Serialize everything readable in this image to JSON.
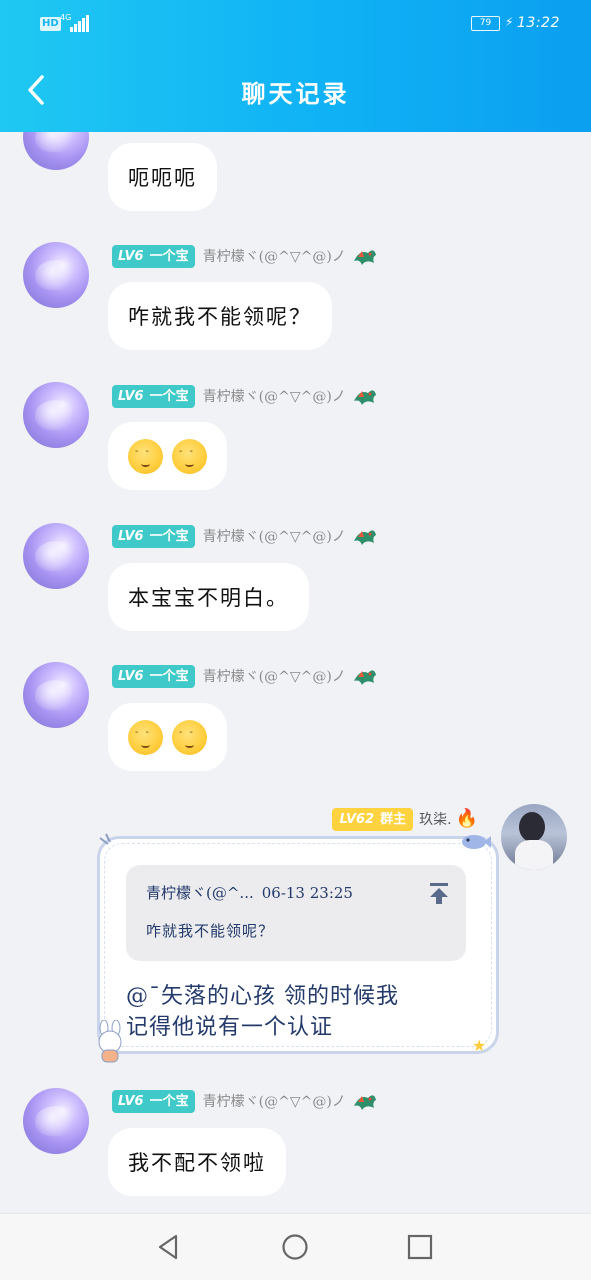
{
  "status_bar": {
    "hd": "HD",
    "network": "4G",
    "battery": "79",
    "time": "13:22"
  },
  "header": {
    "title": "聊天记录"
  },
  "messages": [
    {
      "text": "呃呃呃"
    },
    {
      "level": "LV6",
      "title": "一个宝",
      "name": "青柠檬ヾ(@^▽^@)ノ",
      "text": "咋就我不能领呢？"
    },
    {
      "level": "LV6",
      "title": "一个宝",
      "name": "青柠檬ヾ(@^▽^@)ノ",
      "emoji_count": 2
    },
    {
      "level": "LV6",
      "title": "一个宝",
      "name": "青柠檬ヾ(@^▽^@)ノ",
      "text": "本宝宝不明白。"
    },
    {
      "level": "LV6",
      "title": "一个宝",
      "name": "青柠檬ヾ(@^▽^@)ノ",
      "emoji_count": 2
    },
    {
      "level": "LV6",
      "title": "一个宝",
      "name": "青柠檬ヾ(@^▽^@)ノ",
      "text": "我不配不领啦"
    }
  ],
  "my_message": {
    "level": "LV62",
    "title": "群主",
    "name": "玖柒.",
    "quote_author": "青柠檬ヾ(@^...",
    "quote_time": "06-13 23:25",
    "quote_text": "咋就我不能领呢？",
    "reply_line1": "@¯矢落的心孩 领的时候我",
    "reply_line2": "记得他说有一个认证"
  },
  "colors": {
    "header_start": "#1fc8f2",
    "header_end": "#0b9ff0",
    "member_badge": "#3fc9c8",
    "owner_badge": "#ffd23f",
    "background": "#f1f2f6"
  },
  "icons": [
    "back-arrow-icon",
    "dragon-icon",
    "fire-icon",
    "jump-to-icon",
    "nav-back-icon",
    "nav-home-icon",
    "nav-recent-icon"
  ]
}
